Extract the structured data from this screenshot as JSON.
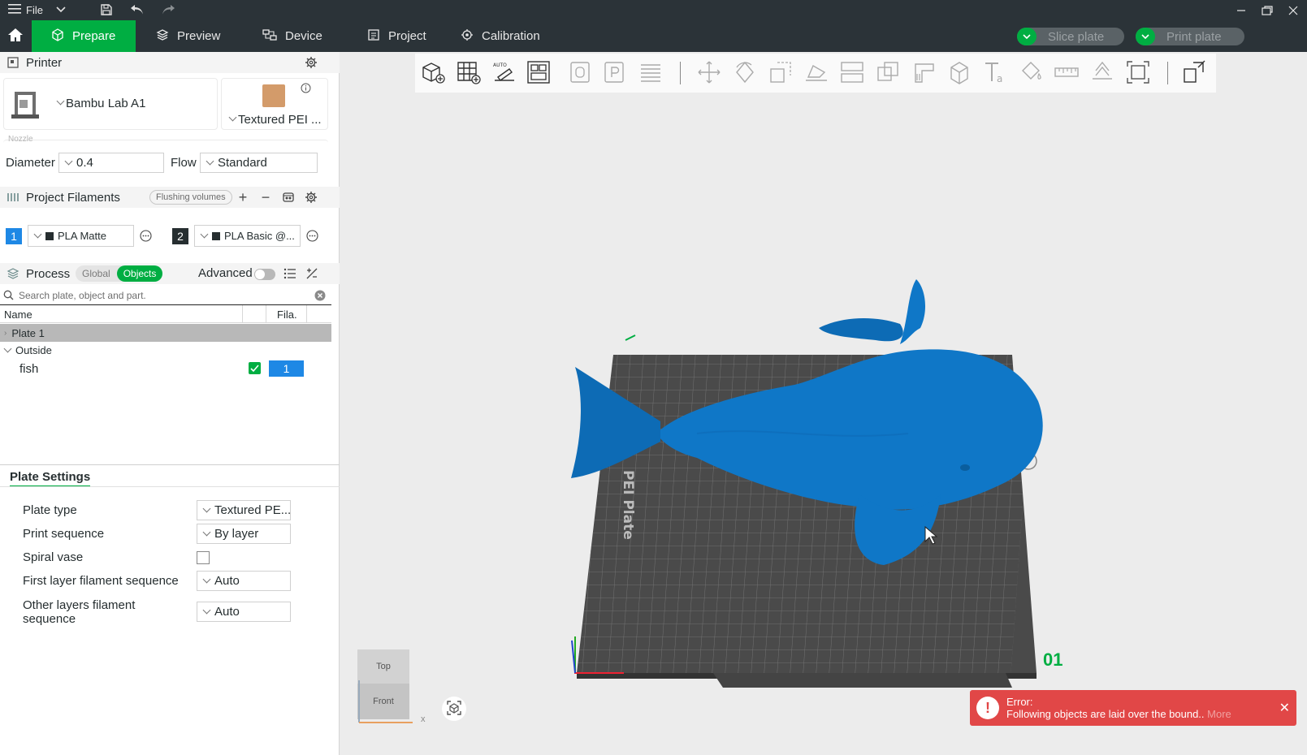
{
  "titlebar": {
    "file_label": "File",
    "icons": [
      "menu-icon",
      "chevron-down-icon",
      "save-icon",
      "undo-icon",
      "redo-icon"
    ],
    "window_controls": [
      "minimize-icon",
      "maximize-icon",
      "close-icon"
    ]
  },
  "tabs": [
    {
      "label": "Prepare",
      "icon": "cube-icon",
      "active": true
    },
    {
      "label": "Preview",
      "icon": "layers-icon",
      "active": false
    },
    {
      "label": "Device",
      "icon": "device-icon",
      "active": false
    },
    {
      "label": "Project",
      "icon": "project-icon",
      "active": false
    },
    {
      "label": "Calibration",
      "icon": "calibration-icon",
      "active": false
    }
  ],
  "actions": {
    "slice_label": "Slice plate",
    "print_label": "Print plate"
  },
  "printer": {
    "section_title": "Printer",
    "printer_name": "Bambu Lab A1",
    "plate_label": "Textured PEI ...",
    "nozzle_label": "Nozzle",
    "diameter_label": "Diameter",
    "diameter_value": "0.4",
    "flow_label": "Flow",
    "flow_value": "Standard"
  },
  "filaments": {
    "section_title": "Project Filaments",
    "flushing_label": "Flushing volumes",
    "items": [
      {
        "num": "1",
        "name": "PLA Matte",
        "color": "#1e88e5"
      },
      {
        "num": "2",
        "name": "PLA Basic @...",
        "color": "#262e30"
      }
    ]
  },
  "process": {
    "section_title": "Process",
    "global_label": "Global",
    "objects_label": "Objects",
    "advanced_label": "Advanced"
  },
  "object_list": {
    "search_placeholder": "Search plate, object and part.",
    "col_name": "Name",
    "col_fila": "Fila.",
    "plate_row": "Plate 1",
    "group_row": "Outside",
    "object_name": "fish",
    "object_filament": "1"
  },
  "plate_settings": {
    "title": "Plate Settings",
    "rows": [
      {
        "label": "Plate type",
        "value": "Textured PE..."
      },
      {
        "label": "Print sequence",
        "value": "By layer"
      },
      {
        "label": "Spiral vase",
        "value": ""
      },
      {
        "label": "First layer filament sequence",
        "value": "Auto"
      },
      {
        "label": "Other layers filament",
        "label2": "sequence",
        "value": "Auto"
      }
    ]
  },
  "viewport": {
    "viewcube_top": "Top",
    "viewcube_front": "Front",
    "axis_x": "x",
    "plate_number": "01",
    "plate_label_vertical": "PEI Plate",
    "colors": {
      "model": "#0f77c7",
      "bed": "#4a4a4a",
      "accent": "#00ae42"
    }
  },
  "error": {
    "title": "Error:",
    "message": "Following objects are laid over the bound..",
    "more": "More"
  }
}
